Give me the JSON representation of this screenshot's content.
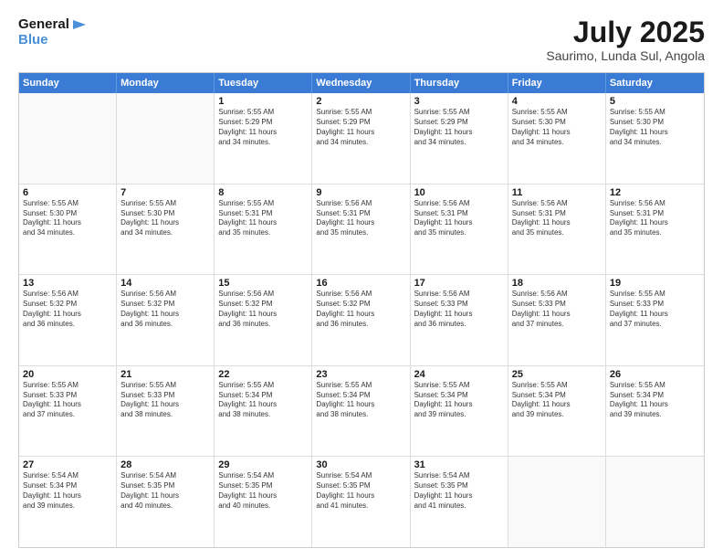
{
  "header": {
    "logo_line1": "General",
    "logo_line2": "Blue",
    "title": "July 2025",
    "subtitle": "Saurimo, Lunda Sul, Angola"
  },
  "days_of_week": [
    "Sunday",
    "Monday",
    "Tuesday",
    "Wednesday",
    "Thursday",
    "Friday",
    "Saturday"
  ],
  "weeks": [
    [
      {
        "day": "",
        "empty": true
      },
      {
        "day": "",
        "empty": true
      },
      {
        "day": "1",
        "line1": "Sunrise: 5:55 AM",
        "line2": "Sunset: 5:29 PM",
        "line3": "Daylight: 11 hours",
        "line4": "and 34 minutes."
      },
      {
        "day": "2",
        "line1": "Sunrise: 5:55 AM",
        "line2": "Sunset: 5:29 PM",
        "line3": "Daylight: 11 hours",
        "line4": "and 34 minutes."
      },
      {
        "day": "3",
        "line1": "Sunrise: 5:55 AM",
        "line2": "Sunset: 5:29 PM",
        "line3": "Daylight: 11 hours",
        "line4": "and 34 minutes."
      },
      {
        "day": "4",
        "line1": "Sunrise: 5:55 AM",
        "line2": "Sunset: 5:30 PM",
        "line3": "Daylight: 11 hours",
        "line4": "and 34 minutes."
      },
      {
        "day": "5",
        "line1": "Sunrise: 5:55 AM",
        "line2": "Sunset: 5:30 PM",
        "line3": "Daylight: 11 hours",
        "line4": "and 34 minutes."
      }
    ],
    [
      {
        "day": "6",
        "line1": "Sunrise: 5:55 AM",
        "line2": "Sunset: 5:30 PM",
        "line3": "Daylight: 11 hours",
        "line4": "and 34 minutes."
      },
      {
        "day": "7",
        "line1": "Sunrise: 5:55 AM",
        "line2": "Sunset: 5:30 PM",
        "line3": "Daylight: 11 hours",
        "line4": "and 34 minutes."
      },
      {
        "day": "8",
        "line1": "Sunrise: 5:55 AM",
        "line2": "Sunset: 5:31 PM",
        "line3": "Daylight: 11 hours",
        "line4": "and 35 minutes."
      },
      {
        "day": "9",
        "line1": "Sunrise: 5:56 AM",
        "line2": "Sunset: 5:31 PM",
        "line3": "Daylight: 11 hours",
        "line4": "and 35 minutes."
      },
      {
        "day": "10",
        "line1": "Sunrise: 5:56 AM",
        "line2": "Sunset: 5:31 PM",
        "line3": "Daylight: 11 hours",
        "line4": "and 35 minutes."
      },
      {
        "day": "11",
        "line1": "Sunrise: 5:56 AM",
        "line2": "Sunset: 5:31 PM",
        "line3": "Daylight: 11 hours",
        "line4": "and 35 minutes."
      },
      {
        "day": "12",
        "line1": "Sunrise: 5:56 AM",
        "line2": "Sunset: 5:31 PM",
        "line3": "Daylight: 11 hours",
        "line4": "and 35 minutes."
      }
    ],
    [
      {
        "day": "13",
        "line1": "Sunrise: 5:56 AM",
        "line2": "Sunset: 5:32 PM",
        "line3": "Daylight: 11 hours",
        "line4": "and 36 minutes."
      },
      {
        "day": "14",
        "line1": "Sunrise: 5:56 AM",
        "line2": "Sunset: 5:32 PM",
        "line3": "Daylight: 11 hours",
        "line4": "and 36 minutes."
      },
      {
        "day": "15",
        "line1": "Sunrise: 5:56 AM",
        "line2": "Sunset: 5:32 PM",
        "line3": "Daylight: 11 hours",
        "line4": "and 36 minutes."
      },
      {
        "day": "16",
        "line1": "Sunrise: 5:56 AM",
        "line2": "Sunset: 5:32 PM",
        "line3": "Daylight: 11 hours",
        "line4": "and 36 minutes."
      },
      {
        "day": "17",
        "line1": "Sunrise: 5:56 AM",
        "line2": "Sunset: 5:33 PM",
        "line3": "Daylight: 11 hours",
        "line4": "and 36 minutes."
      },
      {
        "day": "18",
        "line1": "Sunrise: 5:56 AM",
        "line2": "Sunset: 5:33 PM",
        "line3": "Daylight: 11 hours",
        "line4": "and 37 minutes."
      },
      {
        "day": "19",
        "line1": "Sunrise: 5:55 AM",
        "line2": "Sunset: 5:33 PM",
        "line3": "Daylight: 11 hours",
        "line4": "and 37 minutes."
      }
    ],
    [
      {
        "day": "20",
        "line1": "Sunrise: 5:55 AM",
        "line2": "Sunset: 5:33 PM",
        "line3": "Daylight: 11 hours",
        "line4": "and 37 minutes."
      },
      {
        "day": "21",
        "line1": "Sunrise: 5:55 AM",
        "line2": "Sunset: 5:33 PM",
        "line3": "Daylight: 11 hours",
        "line4": "and 38 minutes."
      },
      {
        "day": "22",
        "line1": "Sunrise: 5:55 AM",
        "line2": "Sunset: 5:34 PM",
        "line3": "Daylight: 11 hours",
        "line4": "and 38 minutes."
      },
      {
        "day": "23",
        "line1": "Sunrise: 5:55 AM",
        "line2": "Sunset: 5:34 PM",
        "line3": "Daylight: 11 hours",
        "line4": "and 38 minutes."
      },
      {
        "day": "24",
        "line1": "Sunrise: 5:55 AM",
        "line2": "Sunset: 5:34 PM",
        "line3": "Daylight: 11 hours",
        "line4": "and 39 minutes."
      },
      {
        "day": "25",
        "line1": "Sunrise: 5:55 AM",
        "line2": "Sunset: 5:34 PM",
        "line3": "Daylight: 11 hours",
        "line4": "and 39 minutes."
      },
      {
        "day": "26",
        "line1": "Sunrise: 5:55 AM",
        "line2": "Sunset: 5:34 PM",
        "line3": "Daylight: 11 hours",
        "line4": "and 39 minutes."
      }
    ],
    [
      {
        "day": "27",
        "line1": "Sunrise: 5:54 AM",
        "line2": "Sunset: 5:34 PM",
        "line3": "Daylight: 11 hours",
        "line4": "and 39 minutes."
      },
      {
        "day": "28",
        "line1": "Sunrise: 5:54 AM",
        "line2": "Sunset: 5:35 PM",
        "line3": "Daylight: 11 hours",
        "line4": "and 40 minutes."
      },
      {
        "day": "29",
        "line1": "Sunrise: 5:54 AM",
        "line2": "Sunset: 5:35 PM",
        "line3": "Daylight: 11 hours",
        "line4": "and 40 minutes."
      },
      {
        "day": "30",
        "line1": "Sunrise: 5:54 AM",
        "line2": "Sunset: 5:35 PM",
        "line3": "Daylight: 11 hours",
        "line4": "and 41 minutes."
      },
      {
        "day": "31",
        "line1": "Sunrise: 5:54 AM",
        "line2": "Sunset: 5:35 PM",
        "line3": "Daylight: 11 hours",
        "line4": "and 41 minutes."
      },
      {
        "day": "",
        "empty": true
      },
      {
        "day": "",
        "empty": true
      }
    ]
  ]
}
